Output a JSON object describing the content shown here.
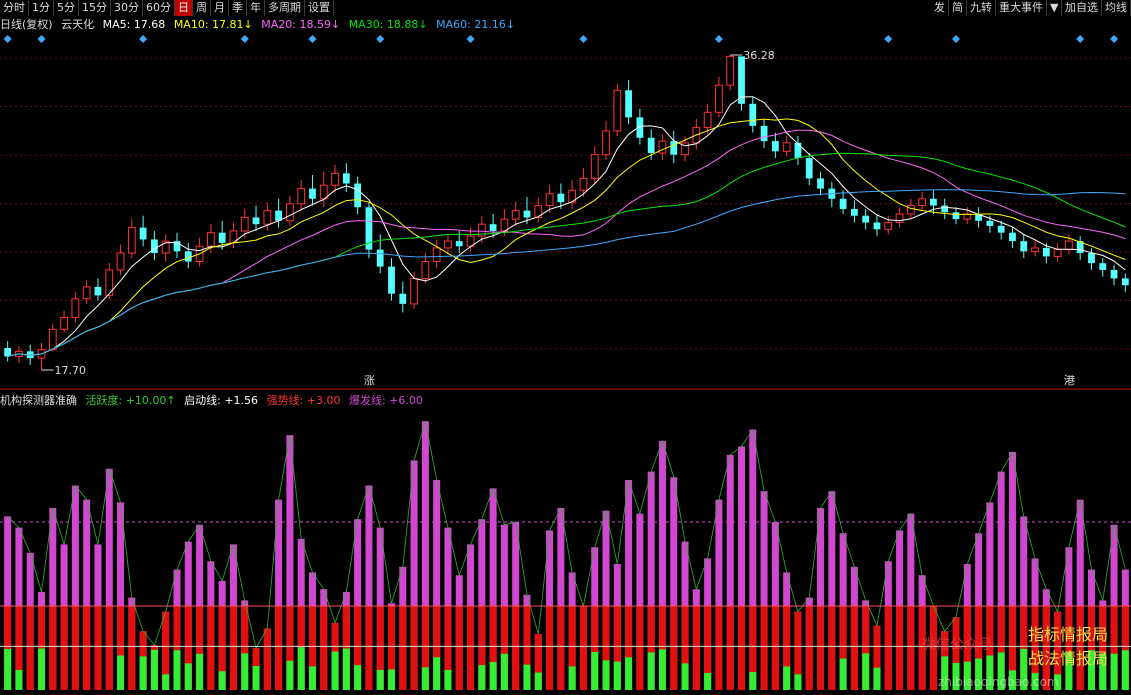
{
  "toolbar": {
    "left": [
      "分时",
      "1分",
      "5分",
      "15分",
      "30分",
      "60分",
      "日",
      "周",
      "月",
      "季",
      "年",
      "多周期",
      "设置"
    ],
    "active": "日",
    "right": [
      "发",
      "简",
      "九转",
      "重大事件",
      "▼",
      "加自选",
      "均线"
    ]
  },
  "main_info": {
    "label": "日线(复权)",
    "stock": "云天化",
    "ma5": "MA5: 17.68",
    "ma10": "MA10: 17.81↓",
    "ma20": "MA20: 18.59↓",
    "ma30": "MA30: 18.88↓",
    "ma60": "MA60: 21.16↓"
  },
  "markers": {
    "high": "36.28",
    "low": "17.70",
    "zhang": "涨",
    "gang": "港"
  },
  "sub_info": {
    "name": "机构探测器准确",
    "activity": "活跃度: +10.00↑",
    "start_line": "启动线: +1.56",
    "strong_line": "强势线: +3.00",
    "burst_line": "爆发线: +6.00"
  },
  "watermark": {
    "left": "微信公众号",
    "right_top": "指标情报局",
    "right_bottom": "战法情报局",
    "site": "zhibiaoqingbao.com"
  },
  "colors": {
    "up": "#ff3232",
    "down": "#54ffff",
    "ma5": "#ffffff",
    "ma10": "#ffff00",
    "ma20": "#ff66ff",
    "ma30": "#00e600",
    "ma60": "#3fa8ff",
    "magenta_bar": "#d247d2",
    "red_bar": "#e31010",
    "green_bar": "#33ee33"
  },
  "chart_data": [
    {
      "type": "candlestick",
      "price_range": [
        17.7,
        36.28
      ],
      "candles": [
        [
          19.0,
          18.5,
          19.4,
          18.2
        ],
        [
          18.5,
          18.8,
          19.1,
          18.1
        ],
        [
          18.8,
          18.4,
          19.2,
          18.0
        ],
        [
          18.4,
          18.9,
          19.3,
          17.7
        ],
        [
          18.9,
          20.1,
          20.4,
          18.8
        ],
        [
          20.1,
          20.8,
          21.2,
          19.9
        ],
        [
          20.8,
          21.9,
          22.3,
          20.5
        ],
        [
          21.9,
          22.6,
          23.0,
          21.6
        ],
        [
          22.6,
          22.1,
          23.1,
          21.8
        ],
        [
          22.1,
          23.6,
          24.0,
          21.9
        ],
        [
          23.6,
          24.6,
          25.1,
          23.3
        ],
        [
          24.6,
          26.1,
          26.6,
          24.3
        ],
        [
          26.1,
          25.4,
          26.8,
          25.0
        ],
        [
          25.4,
          24.6,
          25.9,
          24.2
        ],
        [
          24.6,
          25.3,
          25.7,
          24.1
        ],
        [
          25.3,
          24.7,
          25.8,
          24.3
        ],
        [
          24.7,
          24.1,
          25.2,
          23.7
        ],
        [
          24.1,
          25.0,
          25.5,
          23.8
        ],
        [
          25.0,
          25.8,
          26.3,
          24.6
        ],
        [
          25.8,
          25.2,
          26.5,
          24.8
        ],
        [
          25.2,
          25.9,
          26.4,
          24.9
        ],
        [
          25.9,
          26.7,
          27.2,
          25.5
        ],
        [
          26.7,
          26.3,
          27.4,
          25.9
        ],
        [
          26.3,
          27.1,
          27.6,
          25.9
        ],
        [
          27.1,
          26.5,
          27.8,
          26.1
        ],
        [
          26.5,
          27.5,
          28.0,
          26.2
        ],
        [
          27.5,
          28.4,
          28.9,
          27.1
        ],
        [
          28.4,
          27.8,
          29.2,
          27.4
        ],
        [
          27.8,
          28.6,
          29.4,
          27.3
        ],
        [
          28.6,
          29.3,
          29.8,
          28.2
        ],
        [
          29.3,
          28.7,
          29.9,
          28.2
        ],
        [
          28.7,
          27.3,
          29.1,
          26.9
        ],
        [
          27.3,
          24.8,
          27.6,
          24.3
        ],
        [
          24.8,
          23.8,
          25.7,
          23.4
        ],
        [
          23.8,
          22.2,
          24.3,
          21.8
        ],
        [
          22.2,
          21.6,
          22.9,
          21.1
        ],
        [
          21.6,
          23.1,
          23.5,
          21.3
        ],
        [
          23.1,
          24.1,
          24.6,
          22.8
        ],
        [
          24.1,
          24.9,
          25.4,
          23.7
        ],
        [
          24.9,
          25.3,
          25.7,
          24.5
        ],
        [
          25.3,
          25.0,
          25.9,
          24.6
        ],
        [
          25.0,
          25.6,
          26.1,
          24.7
        ],
        [
          25.6,
          26.3,
          26.8,
          25.2
        ],
        [
          26.3,
          25.9,
          26.9,
          25.5
        ],
        [
          25.9,
          26.6,
          27.2,
          25.6
        ],
        [
          26.6,
          27.1,
          27.6,
          26.2
        ],
        [
          27.1,
          26.7,
          27.9,
          26.3
        ],
        [
          26.7,
          27.4,
          27.9,
          26.4
        ],
        [
          27.4,
          28.1,
          28.6,
          27.0
        ],
        [
          28.1,
          27.6,
          28.7,
          27.2
        ],
        [
          27.6,
          28.3,
          28.9,
          27.2
        ],
        [
          28.3,
          29.0,
          29.6,
          27.9
        ],
        [
          29.0,
          30.4,
          30.9,
          28.7
        ],
        [
          30.4,
          31.8,
          32.4,
          30.1
        ],
        [
          31.8,
          34.2,
          34.6,
          31.5
        ],
        [
          34.2,
          32.6,
          34.8,
          32.2
        ],
        [
          32.6,
          31.4,
          33.1,
          31.0
        ],
        [
          31.4,
          30.5,
          31.9,
          30.1
        ],
        [
          30.5,
          31.2,
          31.6,
          30.1
        ],
        [
          31.2,
          30.4,
          31.8,
          29.9
        ],
        [
          30.4,
          31.1,
          31.5,
          30.0
        ],
        [
          31.1,
          32.0,
          32.5,
          30.7
        ],
        [
          32.0,
          32.9,
          33.4,
          31.6
        ],
        [
          32.9,
          34.5,
          35.0,
          32.6
        ],
        [
          34.5,
          36.2,
          36.28,
          34.2
        ],
        [
          36.2,
          33.4,
          36.0,
          33.0
        ],
        [
          33.4,
          32.1,
          33.8,
          31.7
        ],
        [
          32.1,
          31.2,
          32.5,
          30.8
        ],
        [
          31.2,
          30.6,
          31.7,
          30.2
        ],
        [
          30.6,
          31.1,
          31.5,
          30.3
        ],
        [
          31.1,
          30.2,
          31.5,
          29.8
        ],
        [
          30.2,
          29.0,
          30.5,
          28.6
        ],
        [
          29.0,
          28.4,
          29.4,
          28.0
        ],
        [
          28.4,
          27.8,
          28.8,
          27.3
        ],
        [
          27.8,
          27.2,
          28.3,
          26.9
        ],
        [
          27.2,
          26.8,
          27.7,
          26.4
        ],
        [
          26.8,
          26.4,
          27.2,
          26.0
        ],
        [
          26.4,
          26.0,
          26.9,
          25.6
        ],
        [
          26.0,
          26.4,
          26.8,
          25.7
        ],
        [
          26.4,
          26.9,
          27.3,
          26.1
        ],
        [
          26.9,
          27.4,
          27.8,
          26.6
        ],
        [
          27.4,
          27.8,
          28.2,
          27.1
        ],
        [
          27.8,
          27.4,
          28.3,
          26.9
        ],
        [
          27.4,
          27.0,
          27.8,
          26.6
        ],
        [
          27.0,
          26.6,
          27.3,
          26.3
        ],
        [
          26.6,
          26.9,
          27.3,
          26.3
        ],
        [
          26.9,
          26.5,
          27.3,
          26.1
        ],
        [
          26.5,
          26.2,
          26.8,
          25.8
        ],
        [
          26.2,
          25.8,
          26.5,
          25.4
        ],
        [
          25.8,
          25.3,
          26.1,
          24.9
        ],
        [
          25.3,
          24.7,
          25.7,
          24.3
        ],
        [
          24.7,
          24.9,
          25.3,
          24.4
        ],
        [
          24.9,
          24.4,
          25.2,
          24.0
        ],
        [
          24.4,
          24.8,
          25.2,
          24.1
        ],
        [
          24.8,
          25.3,
          25.7,
          24.5
        ],
        [
          25.3,
          24.6,
          25.6,
          24.2
        ],
        [
          24.6,
          24.0,
          24.9,
          23.6
        ],
        [
          24.0,
          23.6,
          24.3,
          23.2
        ],
        [
          23.6,
          23.1,
          23.9,
          22.7
        ],
        [
          23.1,
          22.7,
          23.4,
          22.3
        ]
      ]
    },
    {
      "type": "bar",
      "name": "机构探测器准确",
      "range": [
        0,
        10
      ],
      "thresholds": {
        "start": 1.56,
        "strong": 3.0,
        "burst": 6.0
      },
      "values": [
        6.2,
        5.8,
        4.9,
        3.5,
        6.5,
        5.2,
        7.3,
        6.8,
        5.2,
        7.9,
        6.7,
        3.3,
        2.1,
        1.6,
        2.8,
        4.3,
        5.3,
        5.9,
        4.6,
        3.9,
        5.2,
        3.2,
        1.5,
        2.2,
        6.8,
        9.1,
        5.4,
        4.2,
        3.6,
        2.4,
        3.5,
        6.1,
        7.3,
        5.8,
        3.1,
        4.4,
        8.2,
        9.6,
        7.5,
        5.8,
        4.1,
        5.2,
        6.1,
        7.2,
        5.9,
        6.0,
        3.4,
        2.0,
        5.7,
        6.5,
        4.2,
        3.0,
        5.1,
        6.4,
        4.5,
        7.5,
        6.3,
        7.8,
        8.9,
        7.6,
        5.3,
        3.6,
        4.7,
        6.8,
        8.4,
        8.7,
        9.3,
        7.1,
        6.0,
        4.2,
        2.8,
        3.3,
        6.5,
        7.1,
        5.6,
        4.4,
        3.2,
        2.3,
        4.6,
        5.7,
        6.3,
        4.1,
        3.0,
        2.1,
        2.6,
        4.5,
        5.6,
        6.7,
        7.8,
        8.5,
        6.2,
        4.7,
        3.6,
        2.8,
        5.1,
        6.8,
        4.3,
        3.2,
        5.9,
        4.3
      ]
    }
  ]
}
